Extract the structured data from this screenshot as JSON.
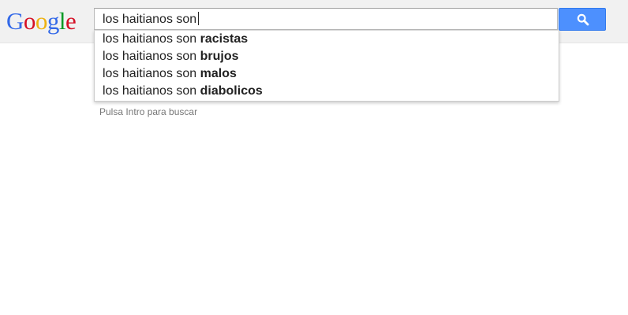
{
  "logo": {
    "letters": [
      "G",
      "o",
      "o",
      "g",
      "l",
      "e"
    ],
    "colors": [
      "#3369e8",
      "#d50f25",
      "#eeb211",
      "#3369e8",
      "#009925",
      "#d50f25"
    ]
  },
  "search": {
    "value": "los haitianos son"
  },
  "search_button": {
    "icon": "search-icon",
    "color": "#4d90fe"
  },
  "suggestions": [
    {
      "prefix": "los haitianos son ",
      "completion": "racistas"
    },
    {
      "prefix": "los haitianos son ",
      "completion": "brujos"
    },
    {
      "prefix": "los haitianos son ",
      "completion": "malos"
    },
    {
      "prefix": "los haitianos son ",
      "completion": "diabolicos"
    }
  ],
  "hint": "Pulsa Intro para buscar"
}
